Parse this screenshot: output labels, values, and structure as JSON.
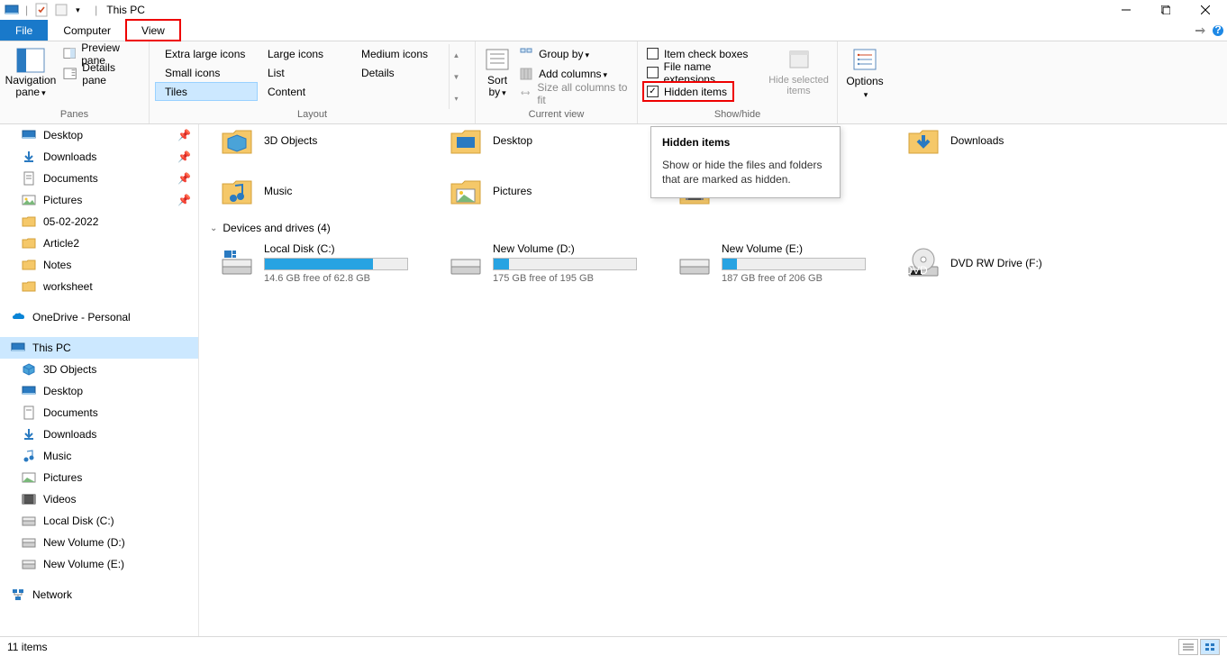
{
  "window": {
    "title": "This PC"
  },
  "tabs": {
    "file": "File",
    "computer": "Computer",
    "view": "View"
  },
  "ribbon": {
    "panes": {
      "label": "Panes",
      "navigation": "Navigation pane",
      "preview": "Preview pane",
      "details": "Details pane"
    },
    "layout": {
      "label": "Layout",
      "items": [
        "Extra large icons",
        "Large icons",
        "Medium icons",
        "Small icons",
        "List",
        "Details",
        "Tiles",
        "Content"
      ],
      "selected": "Tiles"
    },
    "current": {
      "label": "Current view",
      "sort": "Sort by",
      "group": "Group by",
      "add": "Add columns",
      "size": "Size all columns to fit"
    },
    "showhide": {
      "label": "Show/hide",
      "check": "Item check boxes",
      "ext": "File name extensions",
      "hidden": "Hidden items",
      "hide_sel": "Hide selected items"
    },
    "options": "Options"
  },
  "tooltip": {
    "title": "Hidden items",
    "body": "Show or hide the files and folders that are marked as hidden."
  },
  "nav": {
    "desktop": "Desktop",
    "downloads": "Downloads",
    "documents": "Documents",
    "pictures": "Pictures",
    "f1": "05-02-2022",
    "f2": "Article2",
    "f3": "Notes",
    "f4": "worksheet",
    "onedrive": "OneDrive - Personal",
    "thispc": "This PC",
    "obj3d": "3D Objects",
    "desk2": "Desktop",
    "docs2": "Documents",
    "dl2": "Downloads",
    "music": "Music",
    "pics2": "Pictures",
    "videos": "Videos",
    "ldc": "Local Disk (C:)",
    "nvd": "New Volume (D:)",
    "nve": "New Volume (E:)",
    "net": "Network"
  },
  "content": {
    "folders_partial": {
      "obj3d": "3D Objects",
      "desktop": "Desktop",
      "downloads": "Downloads",
      "music": "Music",
      "pictures": "Pictures"
    },
    "drives_header": "Devices and drives (4)",
    "drives": [
      {
        "name": "Local Disk (C:)",
        "free": "14.6 GB free of 62.8 GB",
        "pct": 76
      },
      {
        "name": "New Volume (D:)",
        "free": "175 GB free of 195 GB",
        "pct": 11
      },
      {
        "name": "New Volume (E:)",
        "free": "187 GB free of 206 GB",
        "pct": 10
      },
      {
        "name": "DVD RW Drive (F:)",
        "free": "",
        "pct": null
      }
    ]
  },
  "status": {
    "items": "11 items"
  }
}
